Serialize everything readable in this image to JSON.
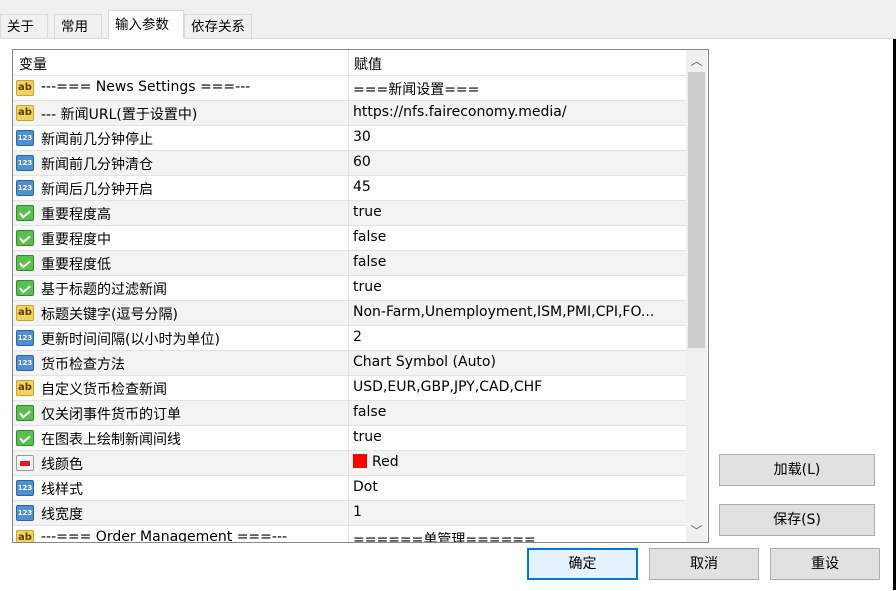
{
  "tabs": [
    {
      "label": "关于"
    },
    {
      "label": "常用"
    },
    {
      "label": "输入参数"
    },
    {
      "label": "依存关系"
    }
  ],
  "grid": {
    "headers": {
      "variable": "变量",
      "value": "赋值"
    },
    "rows": [
      {
        "icon": "ab",
        "name": "---=== News Settings ===---",
        "value": " ===新闻设置==="
      },
      {
        "icon": "ab",
        "name": "--- 新闻URL(置于设置中)",
        "value": "https://nfs.faireconomy.media/"
      },
      {
        "icon": "num",
        "name": "新闻前几分钟停止",
        "value": "30"
      },
      {
        "icon": "num",
        "name": "新闻前几分钟清仓",
        "value": "60"
      },
      {
        "icon": "num",
        "name": "新闻后几分钟开启",
        "value": "45"
      },
      {
        "icon": "bool",
        "name": "重要程度高",
        "value": "true"
      },
      {
        "icon": "bool",
        "name": "重要程度中",
        "value": "false"
      },
      {
        "icon": "bool",
        "name": "重要程度低",
        "value": "false"
      },
      {
        "icon": "bool",
        "name": "基于标题的过滤新闻",
        "value": "true"
      },
      {
        "icon": "ab",
        "name": "标题关键字(逗号分隔)",
        "value": "Non-Farm,Unemployment,ISM,PMI,CPI,FO..."
      },
      {
        "icon": "num",
        "name": "更新时间间隔(以小时为单位)",
        "value": "2"
      },
      {
        "icon": "num",
        "name": "货币检查方法",
        "value": "Chart Symbol (Auto)"
      },
      {
        "icon": "ab",
        "name": "自定义货币检查新闻",
        "value": "USD,EUR,GBP,JPY,CAD,CHF"
      },
      {
        "icon": "bool",
        "name": "仅关闭事件货币的订单",
        "value": "false"
      },
      {
        "icon": "bool",
        "name": "在图表上绘制新闻间线",
        "value": "true"
      },
      {
        "icon": "color",
        "name": "线颜色",
        "value": "Red",
        "color": "#ff0000"
      },
      {
        "icon": "num",
        "name": "线样式",
        "value": "Dot"
      },
      {
        "icon": "num",
        "name": "线宽度",
        "value": "1"
      },
      {
        "icon": "ab",
        "name": "---=== Order Management ===---",
        "value": " ======单管理======"
      }
    ]
  },
  "buttons": {
    "load": "加载(L)",
    "save": "保存(S)",
    "ok": "确定",
    "cancel": "取消",
    "reset": "重设"
  },
  "scrollbar": {
    "up_icon": "chevron-up-icon",
    "down_icon": "chevron-down-icon"
  },
  "colors": {
    "accent": "#0078d7",
    "row_alt": "#f3f3f3"
  }
}
